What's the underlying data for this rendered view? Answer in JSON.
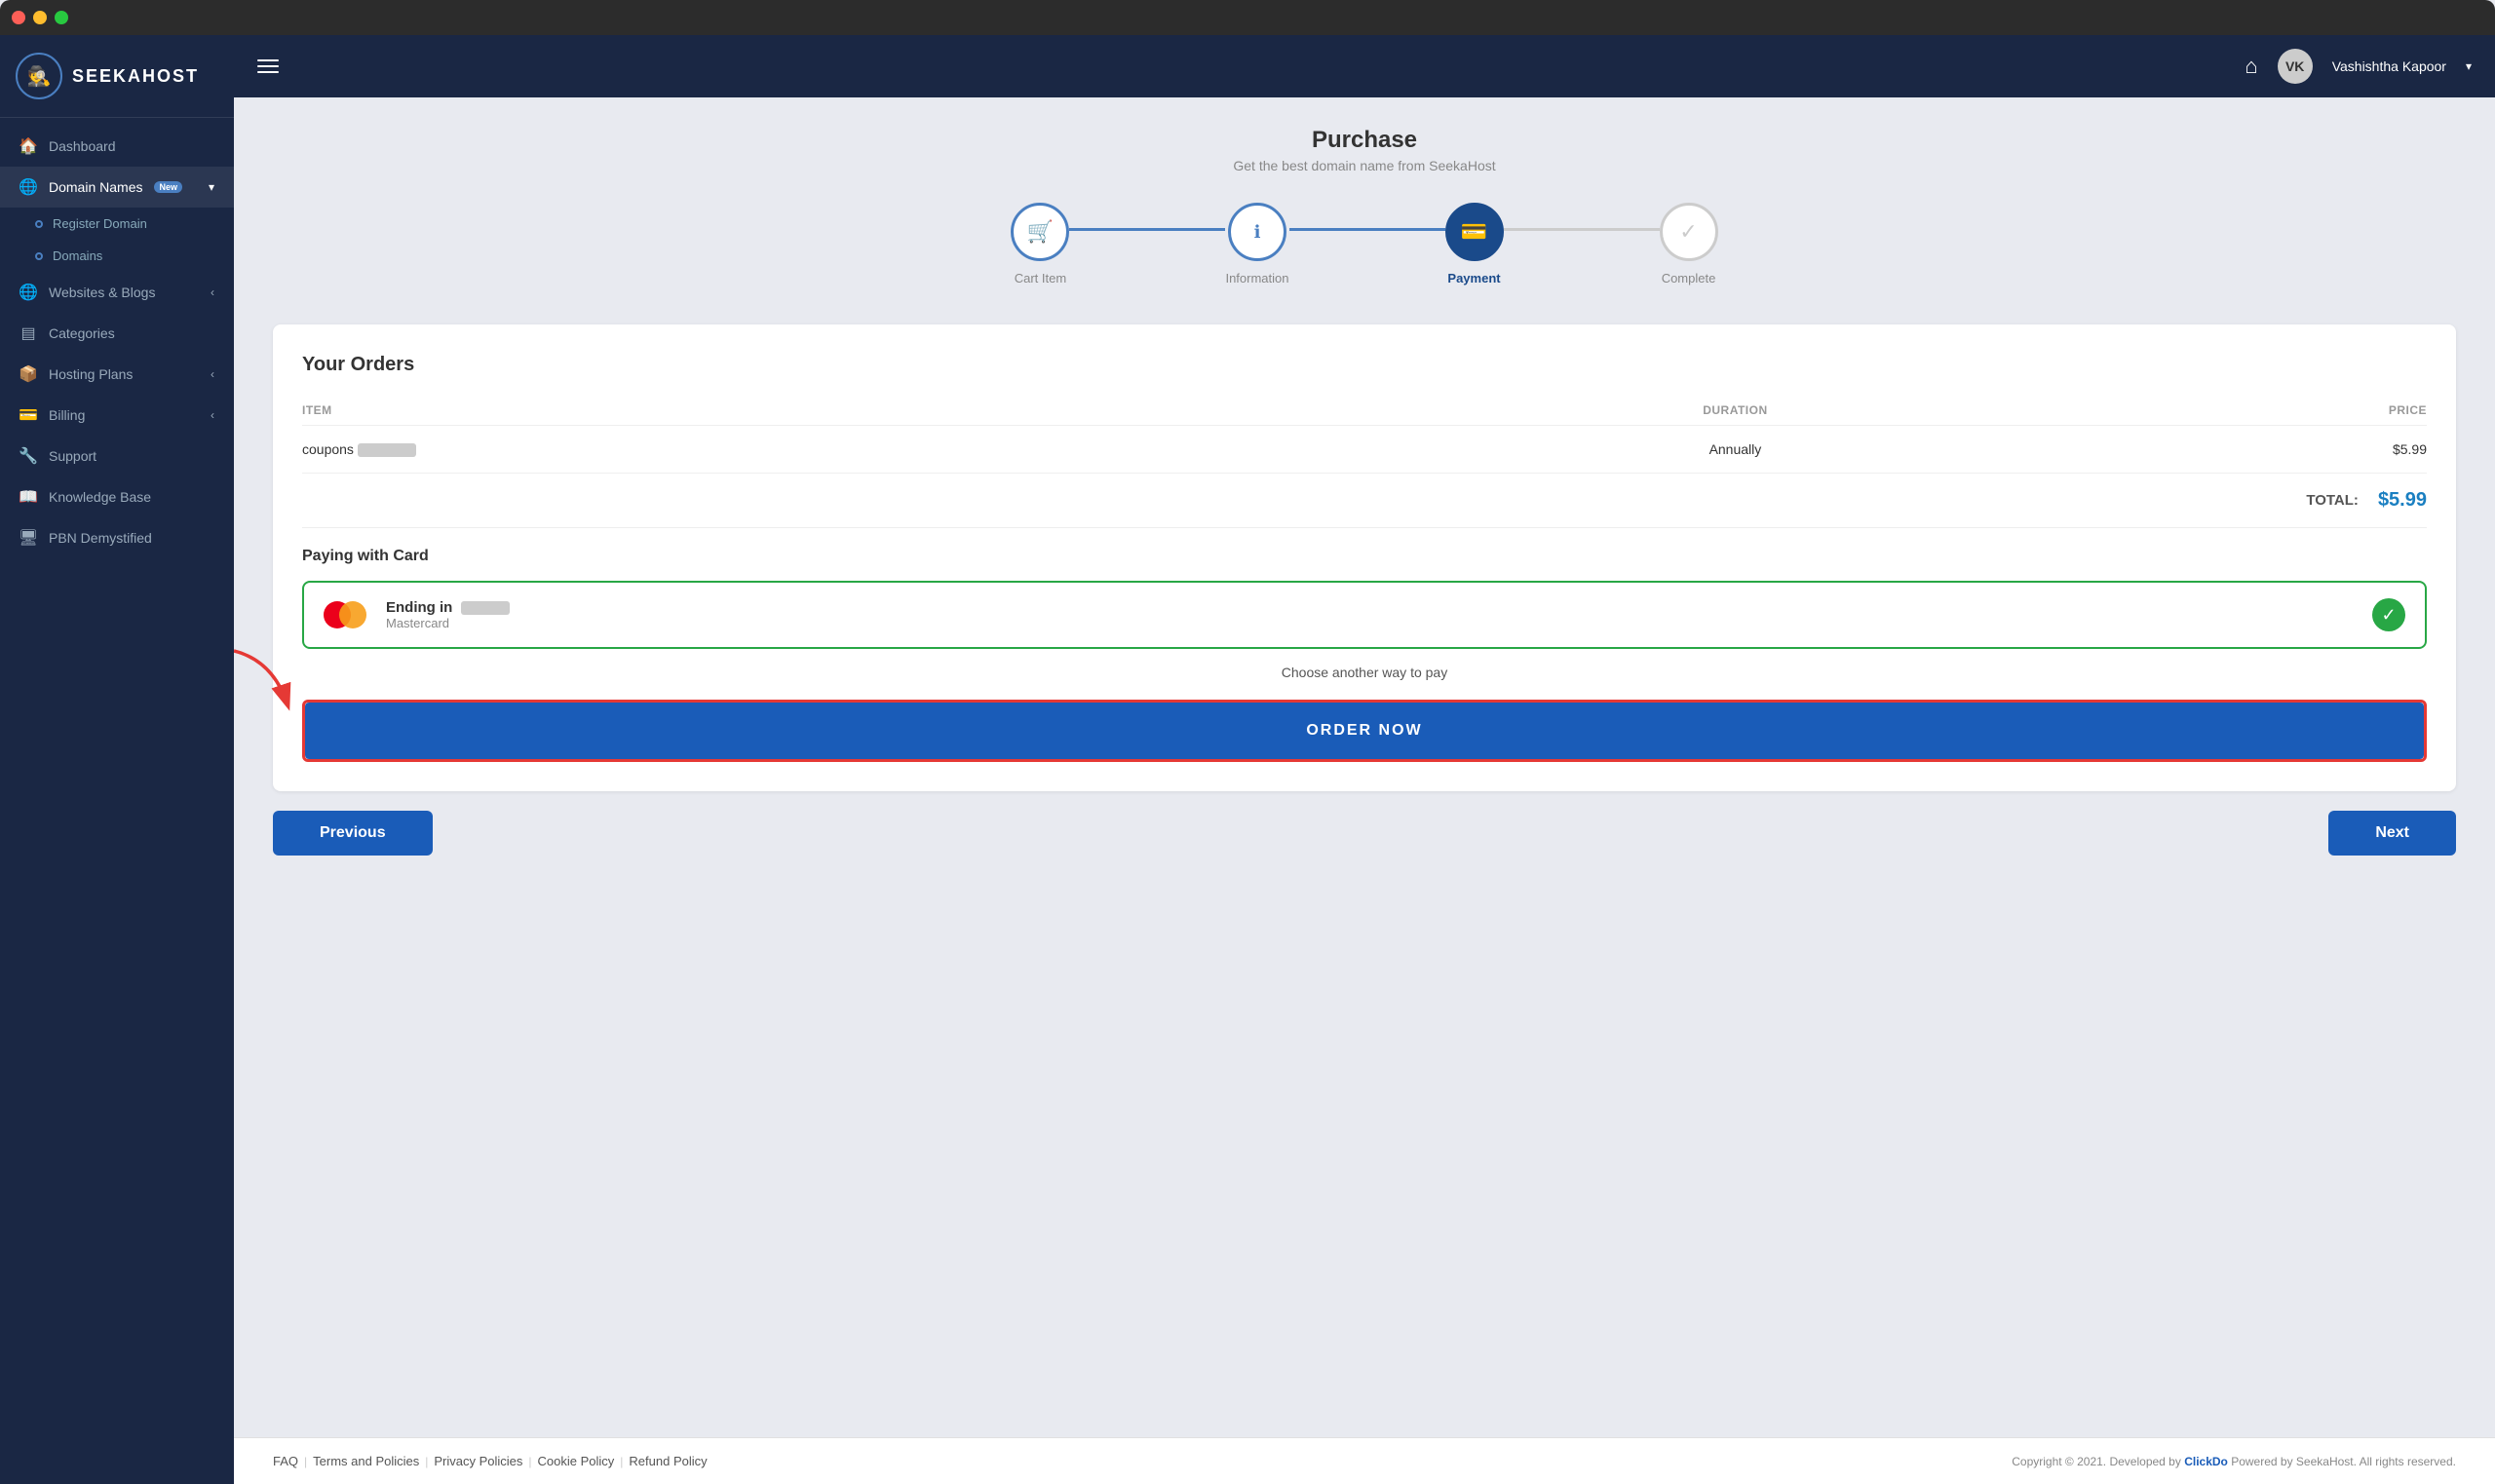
{
  "window": {
    "chrome": {
      "dots": [
        "red",
        "yellow",
        "green"
      ]
    }
  },
  "sidebar": {
    "logo": {
      "text": "SEEKAHOST",
      "tm": "™"
    },
    "items": [
      {
        "id": "dashboard",
        "label": "Dashboard",
        "icon": "🏠",
        "active": false
      },
      {
        "id": "domain-names",
        "label": "Domain Names",
        "icon": "🌐",
        "active": true,
        "badge": "New",
        "has_chevron": true
      },
      {
        "id": "register-domain",
        "label": "Register Domain",
        "sub": true
      },
      {
        "id": "domains",
        "label": "Domains",
        "sub": true
      },
      {
        "id": "websites-blogs",
        "label": "Websites & Blogs",
        "icon": "🌐",
        "active": false,
        "has_chevron": true
      },
      {
        "id": "categories",
        "label": "Categories",
        "icon": "☰",
        "active": false
      },
      {
        "id": "hosting-plans",
        "label": "Hosting Plans",
        "icon": "📦",
        "active": false,
        "has_chevron": true
      },
      {
        "id": "billing",
        "label": "Billing",
        "icon": "💳",
        "active": false,
        "has_chevron": true
      },
      {
        "id": "support",
        "label": "Support",
        "icon": "🔧",
        "active": false
      },
      {
        "id": "knowledge-base",
        "label": "Knowledge Base",
        "icon": "📖",
        "active": false
      },
      {
        "id": "pbn-demystified",
        "label": "PBN Demystified",
        "icon": "🖥",
        "active": false
      }
    ]
  },
  "topbar": {
    "home_label": "Home",
    "user_name": "Vashishtha Kapoor",
    "user_initials": "VK"
  },
  "purchase": {
    "title": "Purchase",
    "subtitle": "Get the best domain name from SeekaHost",
    "steps": [
      {
        "id": "cart-item",
        "label": "Cart Item",
        "icon": "🛒",
        "state": "done"
      },
      {
        "id": "information",
        "label": "Information",
        "icon": "ℹ",
        "state": "done"
      },
      {
        "id": "payment",
        "label": "Payment",
        "icon": "💳",
        "state": "active"
      },
      {
        "id": "complete",
        "label": "Complete",
        "icon": "✓",
        "state": "pending"
      }
    ]
  },
  "orders": {
    "title": "Your Orders",
    "columns": {
      "item": "ITEM",
      "duration": "DURATION",
      "price": "PRICE"
    },
    "rows": [
      {
        "item": "coupons",
        "masked": "••••••",
        "duration": "Annually",
        "price": "$5.99"
      }
    ],
    "total_label": "TOTAL:",
    "total_amount": "$5.99"
  },
  "payment": {
    "section_label": "Paying with Card",
    "card": {
      "ending_label": "Ending in",
      "masked_number": "••••",
      "card_type": "Mastercard"
    },
    "choose_another": "Choose another way to pay",
    "order_btn": "ORDER NOW"
  },
  "navigation": {
    "prev_label": "Previous",
    "next_label": "Next"
  },
  "footer": {
    "links": [
      "FAQ",
      "Terms and Policies",
      "Privacy Policies",
      "Cookie Policy",
      "Refund Policy"
    ],
    "copyright": "Copyright © 2021. Developed by ClickDo Powered by SeekaHost. All rights reserved."
  }
}
